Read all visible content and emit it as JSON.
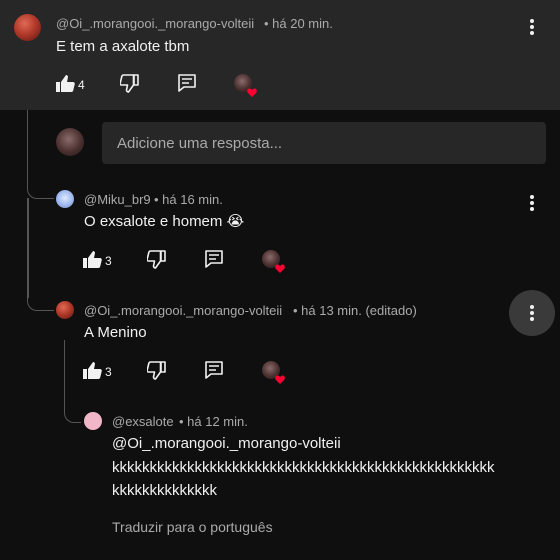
{
  "comments": [
    {
      "author": "@Oi_.morangooi._morango-volteii",
      "time": "• há 20 min.",
      "text": "E tem a axalote tbm",
      "likes": "4"
    },
    {
      "author": "@Miku_br9",
      "time": "• há 16 min.",
      "text": "O exsalote e homem 😭",
      "likes": "3"
    },
    {
      "author": "@Oi_.morangooi._morango-volteii",
      "time": "• há 13 min. (editado)",
      "text": "A Menino",
      "likes": "3"
    },
    {
      "author": "@exsalote",
      "time": "• há 12 min.",
      "text_line1": "@Oi_.morangooi._morango-volteii",
      "text_line2": "kkkkkkkkkkkkkkkkkkkkkkkkkkkkkkkkkkkkkkkkkkkkkkkkkkk",
      "text_line3": "kkkkkkkkkkkkkk",
      "translate": "Traduzir para o português"
    }
  ],
  "reply_input": {
    "placeholder": "Adicione uma resposta..."
  },
  "icons": {
    "like": "thumbs-up-icon",
    "dislike": "thumbs-down-icon",
    "reply": "comment-icon",
    "more": "vertical-dots-icon"
  },
  "colors": {
    "background": "#0f0f0f",
    "highlight": "#272727",
    "heart": "#ff0033"
  }
}
